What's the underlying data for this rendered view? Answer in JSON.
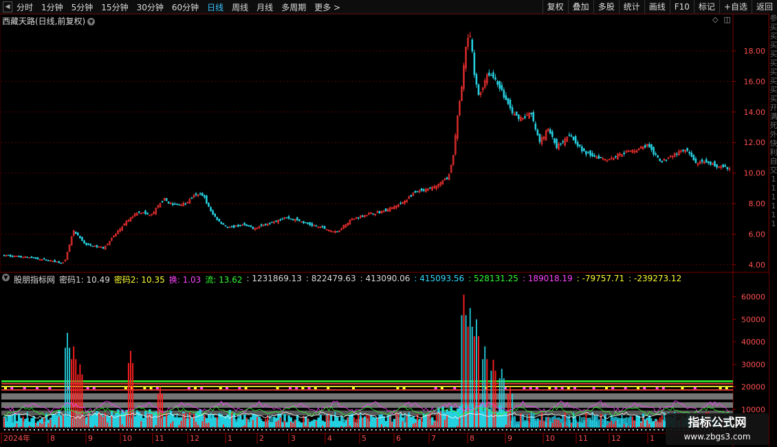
{
  "toolbar": {
    "left": [
      "分时",
      "1分钟",
      "5分钟",
      "15分钟",
      "30分钟",
      "60分钟",
      "日线",
      "周线",
      "月线",
      "多周期",
      "更多 >"
    ],
    "active": "日线",
    "right": [
      "复权",
      "叠加",
      "多股",
      "统计",
      "画线",
      "F10",
      "标记",
      "+自选",
      "返回"
    ]
  },
  "main_title": "西藏天路(日线,前复权)",
  "indicator_header": [
    {
      "text": "股朋指标网",
      "color": "#dddddd"
    },
    {
      "text": "密码1: 10.49",
      "color": "#dddddd"
    },
    {
      "text": "密码2: 10.35",
      "color": "#ffff33"
    },
    {
      "text": "换: 1.03",
      "color": "#ff44ff"
    },
    {
      "text": "流: 13.62",
      "color": "#33ff33"
    },
    {
      "text": ": 1231869.13",
      "color": "#dddddd"
    },
    {
      "text": ": 822479.63",
      "color": "#dddddd"
    },
    {
      "text": ": 413090.06",
      "color": "#dddddd"
    },
    {
      "text": ": 415093.56",
      "color": "#33ddff"
    },
    {
      "text": ": 528131.25",
      "color": "#33ff33"
    },
    {
      "text": ": 189018.19",
      "color": "#ff44ff"
    },
    {
      "text": ": -79757.71",
      "color": "#ffff33"
    },
    {
      "text": ": -239273.12",
      "color": "#ffff33"
    }
  ],
  "sidebar_chars": [
    "参",
    "买",
    "买",
    "买",
    "买",
    "买",
    "买",
    "买",
    "买",
    "买",
    "开",
    "满",
    "死",
    "外",
    "快",
    "利",
    "自",
    "交",
    "1",
    "1",
    "1",
    "1",
    "1",
    "1"
  ],
  "watermark": {
    "line1": "指标公式网",
    "line2": "www.zbgs3.com"
  },
  "colors": {
    "up": "#ff3232",
    "down": "#26d0e0",
    "grid": "#5a0000",
    "axis_text": "#ff5050"
  },
  "chart_data": [
    {
      "type": "candlestick",
      "title": "西藏天路(日线,前复权)",
      "ylim": [
        3.5,
        19.8
      ],
      "yticks": [
        4.0,
        6.0,
        8.0,
        10.0,
        12.0,
        14.0,
        16.0,
        18.0
      ],
      "x_labels": [
        "2024年",
        "8",
        "9",
        "10",
        "11",
        "12",
        "1",
        "2",
        "3",
        "4",
        "5",
        "6",
        "7",
        "8",
        "9",
        "10",
        "11",
        "12",
        "1"
      ],
      "close_path": [
        [
          0,
          4.6
        ],
        [
          10,
          4.5
        ],
        [
          20,
          4.3
        ],
        [
          28,
          4.1
        ],
        [
          32,
          6.2
        ],
        [
          38,
          5.3
        ],
        [
          46,
          5.1
        ],
        [
          56,
          6.7
        ],
        [
          62,
          7.5
        ],
        [
          68,
          7.2
        ],
        [
          74,
          8.3
        ],
        [
          78,
          7.9
        ],
        [
          84,
          8.0
        ],
        [
          88,
          8.5
        ],
        [
          92,
          8.6
        ],
        [
          96,
          7.4
        ],
        [
          100,
          6.8
        ],
        [
          104,
          6.4
        ],
        [
          110,
          6.6
        ],
        [
          116,
          6.4
        ],
        [
          124,
          6.8
        ],
        [
          130,
          7.1
        ],
        [
          136,
          6.9
        ],
        [
          142,
          6.6
        ],
        [
          148,
          6.4
        ],
        [
          154,
          6.1
        ],
        [
          160,
          6.9
        ],
        [
          168,
          7.3
        ],
        [
          176,
          7.5
        ],
        [
          184,
          8.0
        ],
        [
          190,
          8.7
        ],
        [
          196,
          8.9
        ],
        [
          202,
          9.3
        ],
        [
          206,
          9.8
        ],
        [
          208,
          11.0
        ],
        [
          210,
          13.7
        ],
        [
          212,
          15.8
        ],
        [
          214,
          18.4
        ],
        [
          216,
          19.0
        ],
        [
          218,
          16.2
        ],
        [
          220,
          15.0
        ],
        [
          224,
          16.6
        ],
        [
          228,
          16.1
        ],
        [
          232,
          14.9
        ],
        [
          236,
          13.8
        ],
        [
          240,
          13.6
        ],
        [
          244,
          13.9
        ],
        [
          248,
          12.0
        ],
        [
          252,
          12.9
        ],
        [
          256,
          11.7
        ],
        [
          262,
          12.6
        ],
        [
          268,
          11.4
        ],
        [
          274,
          11.1
        ],
        [
          280,
          10.9
        ],
        [
          286,
          11.3
        ],
        [
          292,
          11.5
        ],
        [
          298,
          11.8
        ],
        [
          304,
          10.7
        ],
        [
          310,
          11.2
        ],
        [
          316,
          11.5
        ],
        [
          320,
          10.7
        ],
        [
          326,
          10.6
        ],
        [
          332,
          10.4
        ],
        [
          337,
          10.2
        ]
      ],
      "candles": 345
    },
    {
      "type": "bar",
      "title": "股朋指标网",
      "ylim": [
        0,
        66000
      ],
      "yticks": [
        10000,
        20000,
        30000,
        40000,
        50000,
        60000
      ],
      "volume_peaks": [
        [
          30,
          44000
        ],
        [
          33,
          38000
        ],
        [
          36,
          30000
        ],
        [
          60,
          36000
        ],
        [
          74,
          20000
        ],
        [
          218,
          61000
        ],
        [
          221,
          55000
        ],
        [
          224,
          50000
        ],
        [
          228,
          38000
        ],
        [
          232,
          32000
        ],
        [
          236,
          28000
        ],
        [
          240,
          20000
        ]
      ]
    }
  ]
}
